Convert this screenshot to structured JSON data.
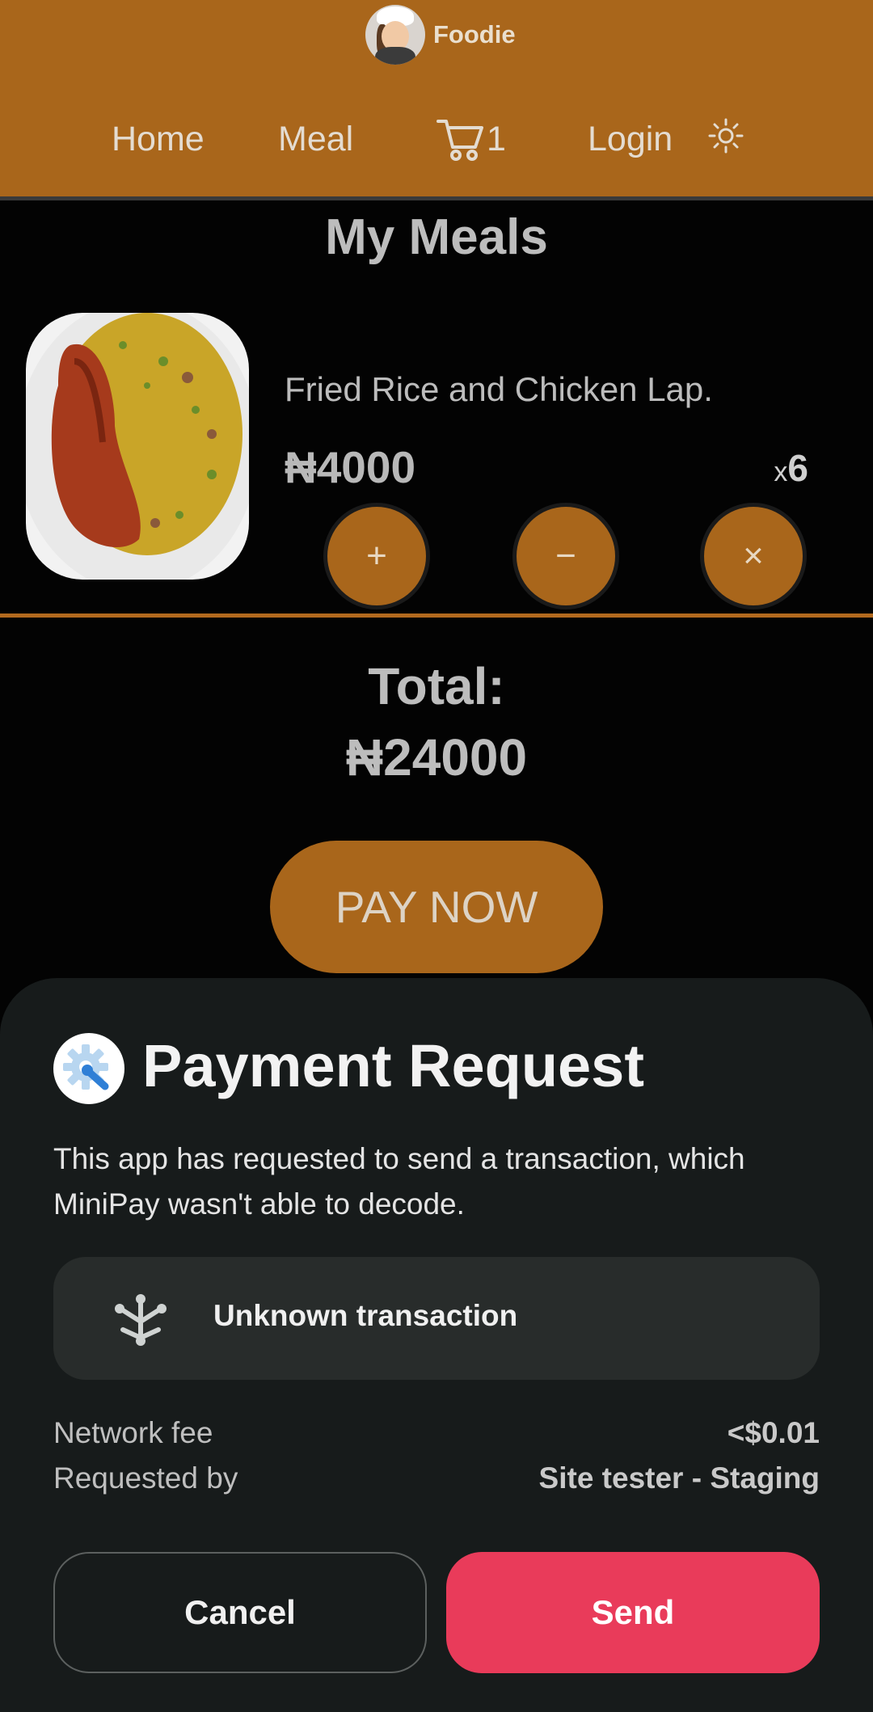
{
  "header": {
    "brand_name": "Foodie",
    "nav": {
      "home": "Home",
      "meal": "Meal",
      "cart_count": "1",
      "login": "Login"
    },
    "icons": {
      "cart": "cart-icon",
      "theme": "sun-icon"
    }
  },
  "page": {
    "title": "My Meals",
    "cart_item": {
      "name": "Fried Rice and Chicken Lap.",
      "price": "₦4000",
      "qty_prefix": "x",
      "qty": "6",
      "buttons": {
        "increase": "+",
        "decrease": "−",
        "remove": "×"
      }
    },
    "total_label": "Total:",
    "total_value": "₦24000",
    "pay_button": "PAY NOW"
  },
  "sheet": {
    "title": "Payment Request",
    "description": "This app has requested to send a transaction, which MiniPay wasn't able to decode.",
    "transaction_label": "Unknown transaction",
    "network_fee_label": "Network fee",
    "network_fee_value": "<$0.01",
    "requested_by_label": "Requested by",
    "requested_by_value": "Site tester - Staging",
    "cancel_button": "Cancel",
    "send_button": "Send"
  },
  "colors": {
    "brand": "#a9661b",
    "send": "#e93b5a",
    "sheet_bg": "#171b1b"
  }
}
